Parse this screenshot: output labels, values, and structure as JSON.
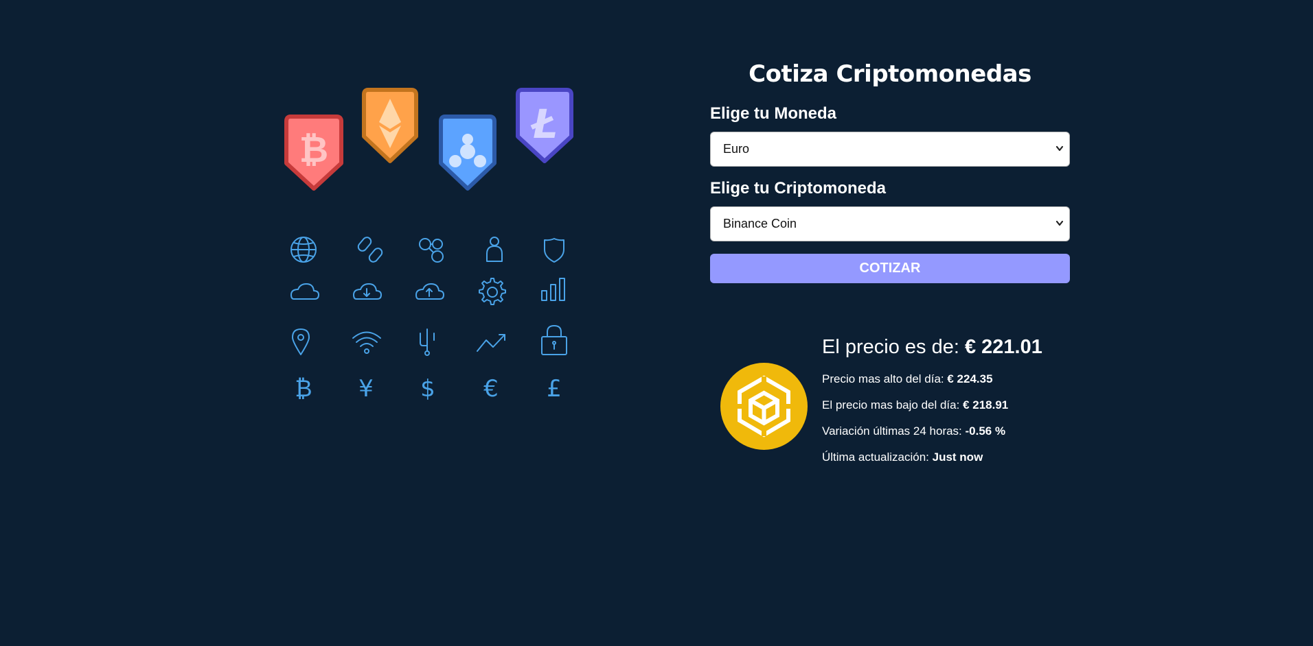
{
  "title": "Cotiza Criptomonedas",
  "form": {
    "currency_label": "Elige tu Moneda",
    "currency_value": "Euro",
    "crypto_label": "Elige tu Criptomoneda",
    "crypto_value": "Binance Coin",
    "submit_label": "COTIZAR"
  },
  "result": {
    "price_label": "El precio es de: ",
    "price_value": "€ 221.01",
    "high_label": "Precio mas alto del día: ",
    "high_value": "€ 224.35",
    "low_label": "El precio mas bajo del día: ",
    "low_value": "€ 218.91",
    "change_label": "Variación últimas 24 horas: ",
    "change_value": "-0.56 %",
    "updated_label": "Última actualización: ",
    "updated_value": "Just now"
  },
  "colors": {
    "background": "#0c1f33",
    "button": "#9499ff",
    "icon_line": "#4aa3e8",
    "binance_yellow": "#f0b90b"
  },
  "illustration": {
    "badges": [
      "bitcoin-badge",
      "ethereum-badge",
      "ripple-badge",
      "litecoin-badge"
    ],
    "icons": [
      "globe-icon",
      "link-icon",
      "network-icon",
      "user-icon",
      "shield-icon",
      "cloud-icon",
      "cloud-download-icon",
      "cloud-upload-icon",
      "gear-icon",
      "bar-chart-icon",
      "location-pin-icon",
      "wifi-icon",
      "fork-icon",
      "trend-up-icon",
      "padlock-icon",
      "bitcoin-icon",
      "yen-icon",
      "dollar-icon",
      "euro-icon",
      "pound-icon"
    ]
  }
}
